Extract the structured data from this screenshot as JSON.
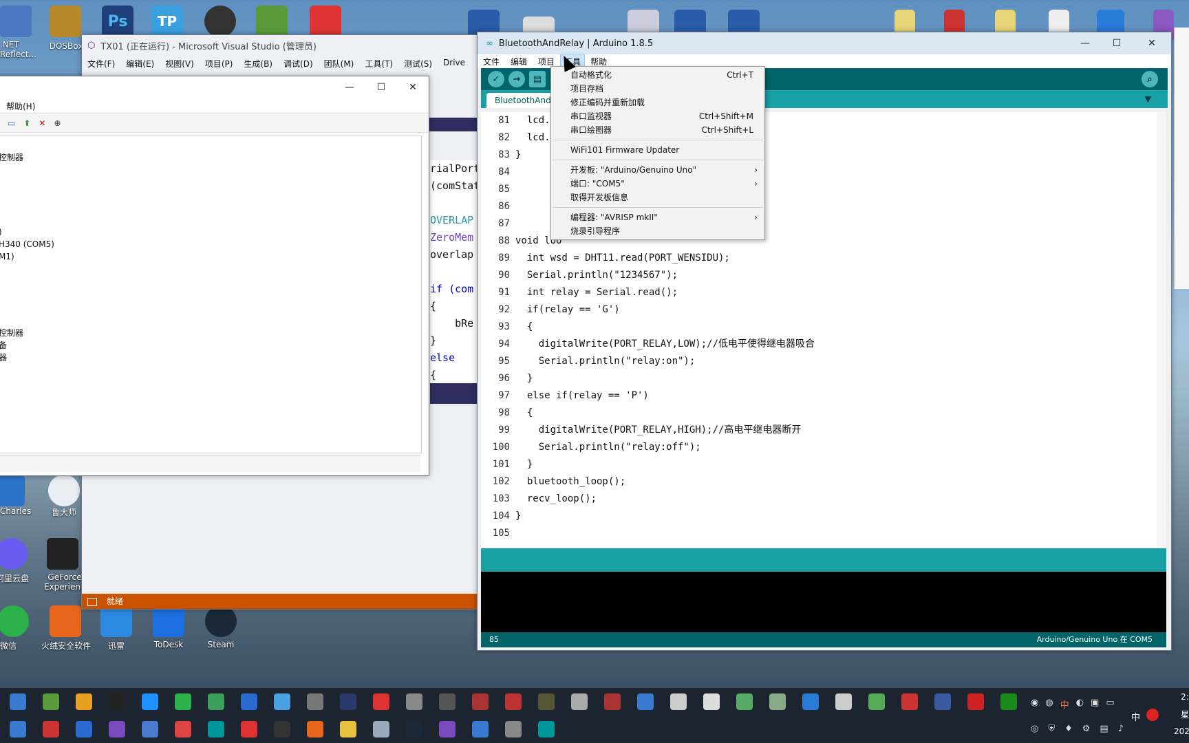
{
  "desktop": {
    "top_icons": [
      {
        "label": ".NET\nReflect...",
        "color": "#4a78c0"
      },
      {
        "label": "DOSBox",
        "color": "#b8892a"
      },
      {
        "label": "",
        "color": "#1f3f7a"
      },
      {
        "label": "",
        "color": "#3aa0e0"
      },
      {
        "label": "",
        "color": "#333"
      },
      {
        "label": "",
        "color": "#5a9a3a"
      },
      {
        "label": "",
        "color": "#d33"
      }
    ],
    "left_icons": [
      {
        "label": "Charles",
        "color": "#2c74c8"
      },
      {
        "label": "鲁大师",
        "color": "#e8eef4"
      },
      {
        "label": "阿里云盘",
        "color": "#6a5cf0"
      },
      {
        "label": "GeForce Experience",
        "color": "#222"
      }
    ],
    "bottom_icons": [
      {
        "label": "微信",
        "color": "#2bb04a"
      },
      {
        "label": "火绒安全软件",
        "color": "#e8661c"
      },
      {
        "label": "迅雷",
        "color": "#2c8ae0"
      },
      {
        "label": "ToDesk",
        "color": "#1b6fe0"
      },
      {
        "label": "Steam",
        "color": "#1b2838"
      }
    ]
  },
  "device_manager": {
    "menu_help": "帮助(H)",
    "tree": [
      {
        "label": "",
        "y": 0
      },
      {
        "label": "控制器",
        "y": 0
      },
      {
        "label": ")",
        "y": 0
      },
      {
        "label": "H340 (COM5)",
        "y": 0
      },
      {
        "label": "M1)",
        "y": 0
      },
      {
        "label": "控制器",
        "y": 0
      },
      {
        "label": "备",
        "y": 0
      },
      {
        "label": "器",
        "y": 0
      }
    ]
  },
  "visual_studio": {
    "title": "TX01 (正在运行) - Microsoft Visual Studio (管理员)",
    "menu": [
      "文件(F)",
      "编辑(E)",
      "视图(V)",
      "项目(P)",
      "生成(B)",
      "调试(D)",
      "团队(M)",
      "工具(T)",
      "测试(S)",
      "Drive"
    ],
    "code": [
      "rialPort",
      "(comStat",
      "",
      "OVERLAP",
      "ZeroMem",
      "overlap",
      "",
      "if (com",
      "{",
      "    bRe",
      "}",
      "else",
      "{"
    ],
    "status": "就绪"
  },
  "arduino": {
    "title": "BluetoothAndRelay | Arduino 1.8.5",
    "menu": [
      "文件",
      "编辑",
      "项目",
      "工具",
      "帮助"
    ],
    "tab": "BluetoothAndR",
    "lines": [
      {
        "n": "81",
        "t": "  lcd.se"
      },
      {
        "n": "82",
        "t": "  lcd.pr"
      },
      {
        "n": "83",
        "t": "}"
      },
      {
        "n": "84",
        "t": ""
      },
      {
        "n": "85",
        "t": ""
      },
      {
        "n": "86",
        "t": ""
      },
      {
        "n": "87",
        "t": ""
      },
      {
        "n": "88",
        "t": "void loo"
      },
      {
        "n": "89",
        "t": "  int wsd = DHT11.read(PORT_WENSIDU);"
      },
      {
        "n": "90",
        "t": "  Serial.println(\"1234567\");"
      },
      {
        "n": "91",
        "t": "  int relay = Serial.read();"
      },
      {
        "n": "92",
        "t": "  if(relay == 'G')"
      },
      {
        "n": "93",
        "t": "  {"
      },
      {
        "n": "94",
        "t": "    digitalWrite(PORT_RELAY,LOW);//低电平使得继电器吸合"
      },
      {
        "n": "95",
        "t": "    Serial.println(\"relay:on\");"
      },
      {
        "n": "96",
        "t": "  }"
      },
      {
        "n": "97",
        "t": "  else if(relay == 'P')"
      },
      {
        "n": "98",
        "t": "  {"
      },
      {
        "n": "99",
        "t": "    digitalWrite(PORT_RELAY,HIGH);//高电平继电器断开"
      },
      {
        "n": "100",
        "t": "    Serial.println(\"relay:off\");"
      },
      {
        "n": "101",
        "t": "  }"
      },
      {
        "n": "102",
        "t": "  bluetooth_loop();"
      },
      {
        "n": "103",
        "t": "  recv_loop();"
      },
      {
        "n": "104",
        "t": "}"
      },
      {
        "n": "105",
        "t": ""
      }
    ],
    "status_line": "85",
    "status_board": "Arduino/Genuino Uno 在 COM5",
    "tools_menu": [
      {
        "label": "自动格式化",
        "shortcut": "Ctrl+T",
        "arrow": ""
      },
      {
        "label": "项目存档",
        "shortcut": "",
        "arrow": ""
      },
      {
        "label": "修正编码并重新加载",
        "shortcut": "",
        "arrow": ""
      },
      {
        "label": "串口监视器",
        "shortcut": "Ctrl+Shift+M",
        "arrow": ""
      },
      {
        "label": "串口绘图器",
        "shortcut": "Ctrl+Shift+L",
        "arrow": ""
      },
      {
        "sep": true
      },
      {
        "label": "WiFi101 Firmware Updater",
        "shortcut": "",
        "arrow": ""
      },
      {
        "sep": true
      },
      {
        "label": "开发板: \"Arduino/Genuino Uno\"",
        "shortcut": "",
        "arrow": "›"
      },
      {
        "label": "端口: \"COM5\"",
        "shortcut": "",
        "arrow": "›"
      },
      {
        "label": "取得开发板信息",
        "shortcut": "",
        "arrow": ""
      },
      {
        "sep": true
      },
      {
        "label": "编程器: \"AVRISP mkII\"",
        "shortcut": "",
        "arrow": "›"
      },
      {
        "label": "烧录引导程序",
        "shortcut": "",
        "arrow": ""
      }
    ]
  },
  "taskbar": {
    "ime": "中",
    "tray_time": "2:",
    "tray_day": "星",
    "tray_date": "202"
  }
}
